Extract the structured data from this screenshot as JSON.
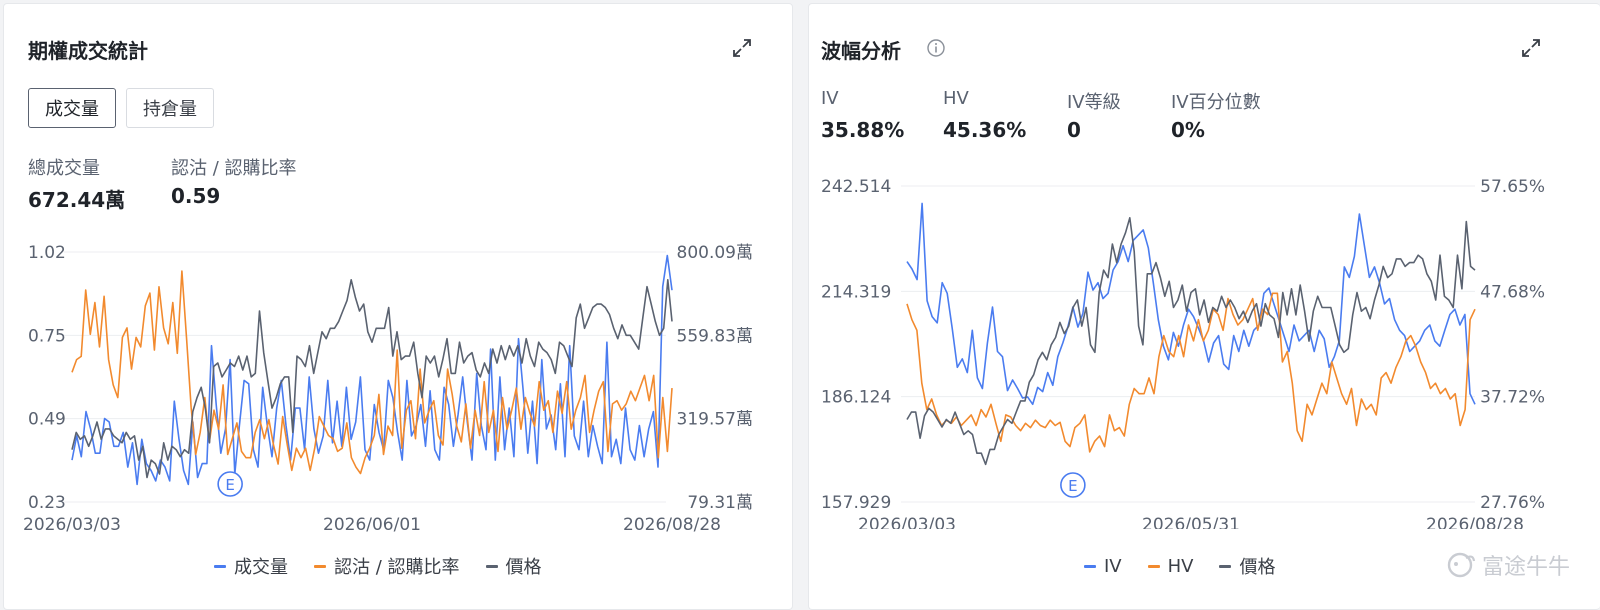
{
  "colors": {
    "blue": "#4a7cf0",
    "orange": "#f28a2e",
    "gray": "#5a6270",
    "grid": "#eceef1",
    "axis_text": "#5a6270"
  },
  "left": {
    "title": "期權成交統計",
    "tabs": [
      {
        "label": "成交量",
        "active": true
      },
      {
        "label": "持倉量",
        "active": false
      }
    ],
    "stats": [
      {
        "label": "總成交量",
        "value": "672.44萬"
      },
      {
        "label": "認沽 / 認購比率",
        "value": "0.59"
      }
    ],
    "legend": [
      {
        "label": "成交量",
        "icon": "blue-line"
      },
      {
        "label": "認沽 / 認購比率",
        "icon": "orange-line"
      },
      {
        "label": "價格",
        "icon": "gray-line"
      }
    ],
    "event_marker": "E"
  },
  "right": {
    "title": "波幅分析",
    "stats": [
      {
        "label": "IV",
        "value": "35.88%"
      },
      {
        "label": "HV",
        "value": "45.36%"
      },
      {
        "label": "IV等級",
        "value": "0"
      },
      {
        "label": "IV百分位數",
        "value": "0%"
      }
    ],
    "legend": [
      {
        "label": "IV",
        "icon": "blue-line"
      },
      {
        "label": "HV",
        "icon": "orange-line"
      },
      {
        "label": "價格",
        "icon": "gray-line"
      }
    ],
    "event_marker": "E"
  },
  "watermark": "富途牛牛",
  "chart_data": [
    {
      "type": "line",
      "title": "",
      "x_ticks": [
        "2026/03/03",
        "2026/06/01",
        "2026/08/28"
      ],
      "y_left_ticks": [
        "1.02",
        "0.75",
        "0.49",
        "0.23"
      ],
      "y_left_range": [
        0.23,
        1.02
      ],
      "y_right_ticks": [
        "800.09萬",
        "559.83萬",
        "319.57萬",
        "79.31萬"
      ],
      "y_right_range": [
        79.31,
        800.09
      ],
      "event_index": 34,
      "series": [
        {
          "name": "成交量",
          "axis": "right",
          "color": "#4a7cf0",
          "values": [
            200,
            270,
            210,
            340,
            290,
            220,
            220,
            320,
            310,
            240,
            240,
            280,
            180,
            250,
            130,
            260,
            190,
            170,
            140,
            200,
            180,
            140,
            370,
            260,
            170,
            130,
            310,
            150,
            190,
            190,
            530,
            360,
            220,
            290,
            490,
            160,
            300,
            430,
            420,
            230,
            180,
            410,
            300,
            210,
            350,
            430,
            300,
            200,
            350,
            350,
            230,
            440,
            290,
            220,
            270,
            430,
            250,
            370,
            240,
            410,
            260,
            310,
            440,
            230,
            200,
            360,
            280,
            230,
            430,
            380,
            280,
            200,
            430,
            270,
            300,
            360,
            240,
            400,
            230,
            200,
            410,
            360,
            240,
            330,
            440,
            310,
            200,
            450,
            300,
            230,
            520,
            200,
            440,
            230,
            350,
            210,
            550,
            400,
            220,
            370,
            190,
            490,
            290,
            330,
            230,
            420,
            210,
            530,
            270,
            230,
            370,
            210,
            300,
            240,
            190,
            540,
            210,
            260,
            190,
            350,
            230,
            200,
            300,
            210,
            290,
            340,
            180,
            700,
            790,
            690
          ]
        },
        {
          "name": "認沽 / 認購比率",
          "axis": "left",
          "color": "#f28a2e",
          "values": [
            0.64,
            0.68,
            0.69,
            0.9,
            0.76,
            0.86,
            0.72,
            0.88,
            0.68,
            0.6,
            0.56,
            0.75,
            0.78,
            0.65,
            0.75,
            0.72,
            0.85,
            0.89,
            0.71,
            0.91,
            0.78,
            0.73,
            0.86,
            0.7,
            0.96,
            0.75,
            0.53,
            0.38,
            0.45,
            0.56,
            0.42,
            0.52,
            0.46,
            0.6,
            0.38,
            0.43,
            0.48,
            0.39,
            0.37,
            0.37,
            0.45,
            0.49,
            0.43,
            0.49,
            0.41,
            0.35,
            0.5,
            0.41,
            0.33,
            0.4,
            0.37,
            0.4,
            0.33,
            0.4,
            0.5,
            0.47,
            0.44,
            0.43,
            0.39,
            0.4,
            0.48,
            0.37,
            0.34,
            0.32,
            0.37,
            0.4,
            0.44,
            0.57,
            0.38,
            0.47,
            0.44,
            0.71,
            0.4,
            0.52,
            0.55,
            0.43,
            0.65,
            0.48,
            0.52,
            0.55,
            0.44,
            0.41,
            0.65,
            0.57,
            0.47,
            0.42,
            0.54,
            0.4,
            0.52,
            0.44,
            0.61,
            0.45,
            0.52,
            0.39,
            0.56,
            0.46,
            0.52,
            0.59,
            0.46,
            0.56,
            0.51,
            0.47,
            0.61,
            0.52,
            0.55,
            0.45,
            0.58,
            0.51,
            0.61,
            0.46,
            0.52,
            0.56,
            0.63,
            0.45,
            0.52,
            0.58,
            0.61,
            0.39,
            0.54,
            0.55,
            0.52,
            0.54,
            0.58,
            0.55,
            0.59,
            0.63,
            0.55,
            0.63,
            0.37,
            0.56,
            0.39,
            0.59
          ]
        },
        {
          "name": "價格",
          "axis": "right",
          "color": "#5a6270",
          "values": [
            230,
            280,
            260,
            270,
            240,
            270,
            310,
            260,
            290,
            290,
            270,
            260,
            250,
            280,
            260,
            270,
            200,
            240,
            150,
            200,
            190,
            160,
            250,
            200,
            240,
            230,
            210,
            230,
            220,
            340,
            380,
            410,
            350,
            250,
            470,
            480,
            440,
            460,
            480,
            470,
            500,
            460,
            500,
            440,
            450,
            630,
            510,
            430,
            350,
            380,
            420,
            440,
            440,
            280,
            500,
            490,
            470,
            530,
            450,
            510,
            570,
            550,
            580,
            580,
            600,
            630,
            660,
            720,
            670,
            630,
            650,
            570,
            540,
            580,
            580,
            580,
            640,
            500,
            570,
            490,
            500,
            500,
            540,
            450,
            380,
            500,
            480,
            500,
            440,
            490,
            550,
            450,
            450,
            540,
            480,
            500,
            510,
            460,
            440,
            480,
            450,
            520,
            480,
            530,
            490,
            530,
            500,
            530,
            480,
            550,
            500,
            470,
            540,
            520,
            510,
            490,
            450,
            540,
            530,
            500,
            470,
            610,
            650,
            580,
            610,
            640,
            650,
            650,
            640,
            620,
            580,
            550,
            590,
            560,
            560,
            540,
            520,
            610,
            700,
            650,
            600,
            560,
            580,
            720,
            600
          ]
        }
      ]
    },
    {
      "type": "line",
      "title": "",
      "x_ticks": [
        "2026/03/03",
        "2026/05/31",
        "2026/08/28"
      ],
      "y_left_ticks": [
        "242.514",
        "214.319",
        "186.124",
        "157.929"
      ],
      "y_left_range": [
        157.929,
        242.514
      ],
      "y_right_ticks": [
        "57.65%",
        "47.68%",
        "37.72%",
        "27.76%"
      ],
      "y_right_range": [
        27.76,
        57.65
      ],
      "event_index": 33,
      "series": [
        {
          "name": "IV",
          "axis": "right",
          "color": "#4a7cf0",
          "values": [
            50.5,
            49.8,
            48.8,
            56.0,
            46.8,
            45.3,
            44.7,
            48.5,
            47.5,
            44.2,
            40.5,
            41.3,
            40.0,
            44.0,
            39.5,
            38.5,
            42.8,
            46.2,
            42.0,
            41.5,
            38.3,
            39.3,
            38.5,
            37.6,
            37.7,
            37.0,
            38.6,
            38.2,
            40.0,
            38.8,
            41.5,
            42.8,
            44.3,
            46.2,
            44.3,
            45.6,
            49.5,
            47.8,
            48.5,
            47.0,
            47.5,
            49.7,
            50.5,
            52.0,
            50.5,
            52.5,
            53.0,
            53.5,
            51.8,
            48.5,
            45.0,
            42.5,
            41.2,
            43.8,
            42.5,
            44.5,
            46.0,
            45.3,
            44.2,
            43.0,
            41.0,
            42.8,
            43.5,
            40.8,
            40.3,
            43.5,
            42.0,
            44.0,
            42.5,
            44.0,
            44.5,
            47.5,
            48.0,
            46.5,
            45.0,
            43.5,
            42.0,
            44.5,
            43.0,
            43.5,
            44.0,
            42.0,
            44.0,
            43.2,
            40.5,
            41.5,
            43.0,
            50.0,
            49.0,
            51.0,
            55.0,
            52.0,
            49.0,
            50.0,
            48.5,
            46.5,
            47.0,
            45.0,
            44.0,
            43.5,
            42.0,
            42.5,
            43.0,
            44.0,
            44.5,
            43.0,
            42.5,
            44.0,
            45.5,
            46.0,
            44.5,
            45.5,
            38.0,
            37.0
          ]
        },
        {
          "name": "HV",
          "axis": "right",
          "color": "#f28a2e",
          "values": [
            46.5,
            45.0,
            44.0,
            39.0,
            36.5,
            37.5,
            36.0,
            35.0,
            35.5,
            35.2,
            35.8,
            35.0,
            35.5,
            36.0,
            35.0,
            36.5,
            35.8,
            37.0,
            35.2,
            33.5,
            36.0,
            35.8,
            35.0,
            34.5,
            35.2,
            34.8,
            35.5,
            35.0,
            34.8,
            35.5,
            35.0,
            35.3,
            33.5,
            33.0,
            34.8,
            35.2,
            36.0,
            32.5,
            33.5,
            34.0,
            33.0,
            36.0,
            34.5,
            34.8,
            34.0,
            37.0,
            38.5,
            38.0,
            38.0,
            39.5,
            38.0,
            41.5,
            43.5,
            42.0,
            41.5,
            43.5,
            41.5,
            44.5,
            43.0,
            45.0,
            43.0,
            44.0,
            46.0,
            45.5,
            44.0,
            47.0,
            45.5,
            44.5,
            45.0,
            46.0,
            47.0,
            44.0,
            46.0,
            45.5,
            47.5,
            47.5,
            41.0,
            42.0,
            39.0,
            34.5,
            33.5,
            37.0,
            36.0,
            37.5,
            39.0,
            38.0,
            41.0,
            39.5,
            38.0,
            37.0,
            38.5,
            35.0,
            37.5,
            36.5,
            37.0,
            36.0,
            39.5,
            40.0,
            39.0,
            40.5,
            41.5,
            43.0,
            43.5,
            42.5,
            41.0,
            40.0,
            38.5,
            39.0,
            38.0,
            38.5,
            37.5,
            38.0,
            35.0,
            36.5,
            45.0,
            46.0
          ]
        },
        {
          "name": "價格",
          "axis": "left",
          "color": "#5a6270",
          "values": [
            180,
            182,
            182,
            175,
            181,
            183,
            182,
            180,
            178,
            180,
            179,
            182,
            179,
            176,
            177,
            176,
            171,
            171,
            168,
            172,
            172,
            176,
            178,
            180,
            179,
            182,
            185,
            185,
            190,
            192,
            196,
            198,
            196,
            200,
            202,
            206,
            203,
            205,
            210,
            212,
            205,
            210,
            200,
            198,
            214,
            220,
            218,
            227,
            222,
            227,
            230,
            234,
            225,
            205,
            200,
            219,
            219,
            222,
            218,
            213,
            217,
            210,
            212,
            216,
            209,
            214,
            215,
            208,
            212,
            206,
            210,
            209,
            213,
            210,
            212,
            210,
            207,
            209,
            206,
            209,
            211,
            205,
            211,
            208,
            207,
            202,
            214,
            208,
            215,
            208,
            216,
            209,
            201,
            209,
            213,
            210,
            210,
            210,
            205,
            200,
            198,
            199,
            208,
            214,
            209,
            210,
            207,
            212,
            216,
            221,
            218,
            219,
            223,
            223,
            221,
            222,
            222,
            224,
            223,
            219,
            217,
            212,
            224,
            213,
            212,
            210,
            224,
            215,
            233,
            221,
            220
          ]
        }
      ]
    }
  ]
}
